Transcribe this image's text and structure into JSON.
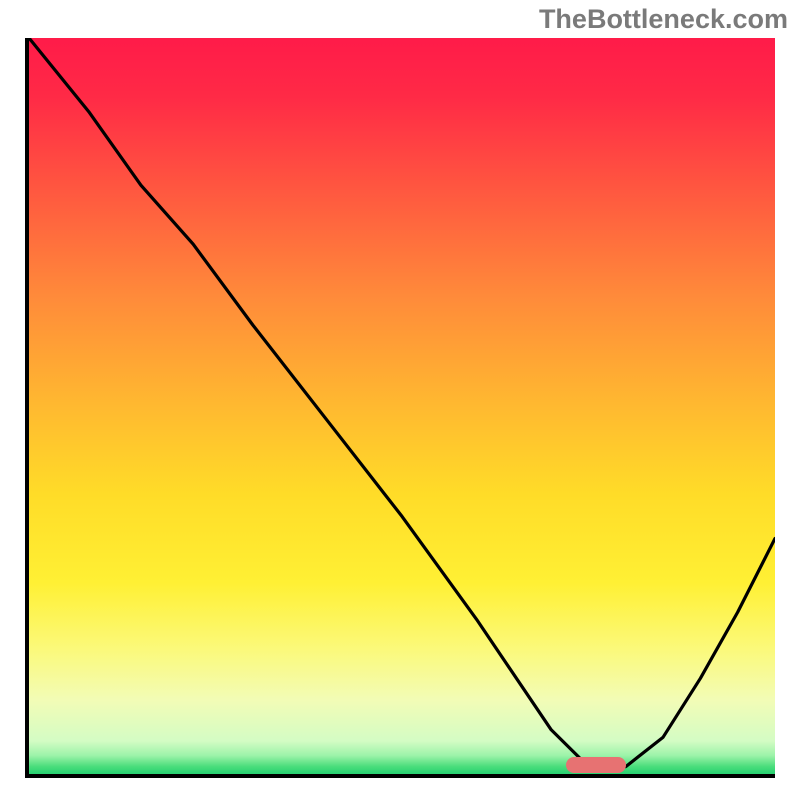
{
  "watermark": "TheBottleneck.com",
  "colors": {
    "gradient_stops": [
      {
        "offset": 0.0,
        "color": "#ff1b49"
      },
      {
        "offset": 0.08,
        "color": "#ff2a46"
      },
      {
        "offset": 0.2,
        "color": "#ff5540"
      },
      {
        "offset": 0.35,
        "color": "#ff8a3a"
      },
      {
        "offset": 0.5,
        "color": "#ffb930"
      },
      {
        "offset": 0.62,
        "color": "#ffdc28"
      },
      {
        "offset": 0.74,
        "color": "#fff034"
      },
      {
        "offset": 0.83,
        "color": "#fbf97a"
      },
      {
        "offset": 0.9,
        "color": "#f2fcb6"
      },
      {
        "offset": 0.955,
        "color": "#d4fcc4"
      },
      {
        "offset": 0.975,
        "color": "#9cf3a9"
      },
      {
        "offset": 0.99,
        "color": "#49dd7b"
      },
      {
        "offset": 1.0,
        "color": "#28d172"
      }
    ],
    "curve": "#000000",
    "axis": "#000000",
    "marker": "#e77272"
  },
  "chart_data": {
    "type": "line",
    "title": "",
    "xlabel": "",
    "ylabel": "",
    "xlim": [
      0,
      100
    ],
    "ylim": [
      0,
      100
    ],
    "series": [
      {
        "name": "bottleneck-curve",
        "x": [
          0,
          8,
          15,
          22,
          30,
          40,
          50,
          60,
          66,
          70,
          74,
          76,
          80,
          85,
          90,
          95,
          100
        ],
        "y": [
          100,
          90,
          80,
          72,
          61,
          48,
          35,
          21,
          12,
          6,
          2,
          1,
          1,
          5,
          13,
          22,
          32
        ]
      }
    ],
    "annotations": [
      {
        "name": "optimal-range-marker",
        "x_start": 72,
        "x_end": 80,
        "y": 1.2
      }
    ],
    "notes": "No axis tick labels are visible; values estimated on a normalized 0–100 scale reading pixel positions against the framed plot area."
  }
}
